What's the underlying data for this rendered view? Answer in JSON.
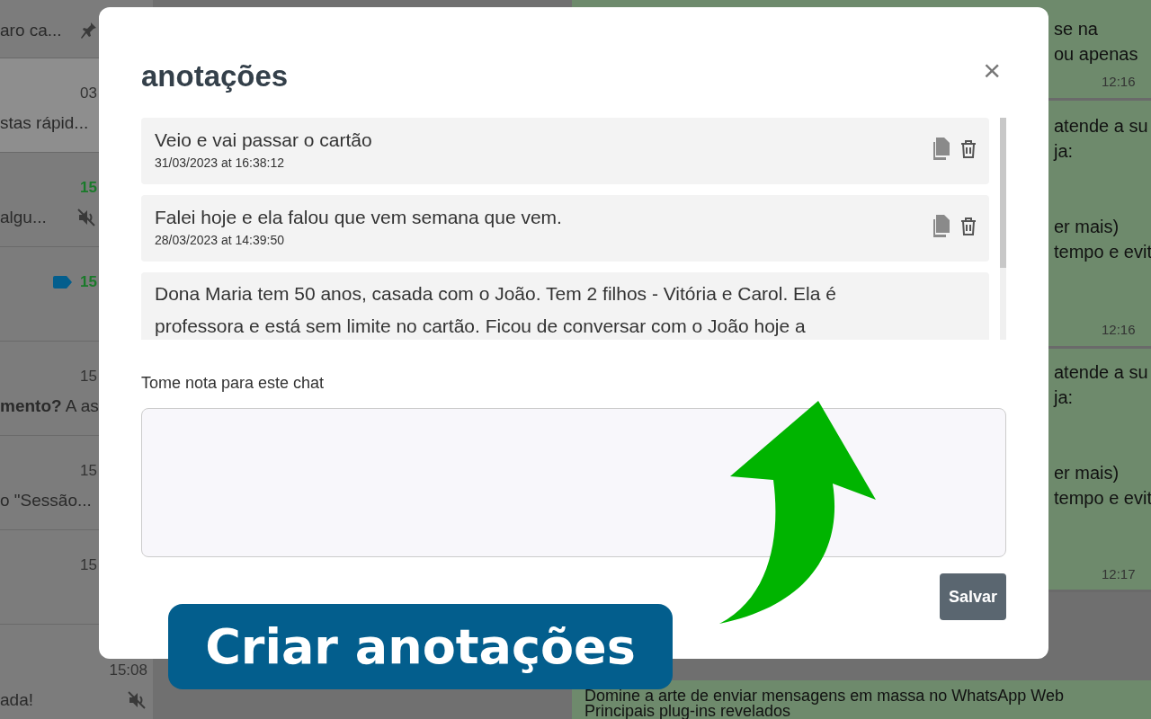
{
  "chat_list": [
    {
      "kind": "pin",
      "preview": "aro ca...",
      "selected": false
    },
    {
      "time": "03",
      "unread": false,
      "preview": "stas rápid...",
      "selected": true
    },
    {
      "time": "15",
      "unread": true,
      "kind": "muted",
      "preview": "algu...",
      "selected": false
    },
    {
      "time": "15",
      "unread": true,
      "kind": "tag",
      "selected": false
    },
    {
      "time": "15",
      "unread": false,
      "preview": "**mento?** A as",
      "selected": false
    },
    {
      "time": "15",
      "unread": false,
      "preview": "o \"Sessão...",
      "selected": false
    },
    {
      "time": "15",
      "unread": false,
      "selected": false
    },
    {
      "time": "15:08",
      "unread": false,
      "kind": "muted",
      "preview": "ada!",
      "selected": false
    }
  ],
  "messages": [
    {
      "paragraphs": [
        [
          "se na",
          "ou apenas"
        ]
      ],
      "time": "12:16"
    },
    {
      "paragraphs": [
        [
          "atende a su",
          "ja:"
        ],
        [
          "er mais)",
          "tempo e evit"
        ]
      ],
      "time": "12:16"
    },
    {
      "paragraphs": [
        [
          "atende a su",
          "ja:"
        ],
        [
          "er mais)",
          "tempo e evit"
        ]
      ],
      "time": "12:17"
    },
    {
      "paragraphs": [
        [
          "Domine a arte de enviar mensagens em massa no WhatsApp Web",
          "Principais plug-ins revelados"
        ]
      ]
    }
  ],
  "dialog": {
    "title": "anotações",
    "close": "×",
    "notes": [
      {
        "text": "Veio e vai passar o cartão",
        "date": "31/03/2023 at 16:38:12"
      },
      {
        "text": "Falei hoje e ela falou que vem semana que vem.",
        "date": "28/03/2023 at 14:39:50"
      },
      {
        "text": "Dona Maria tem 50 anos, casada com o João. Tem 2 filhos - Vitória e Carol. Ela é professora e está sem limite no cartão. Ficou de conversar com o João hoje a"
      }
    ],
    "label": "Tome nota para este chat",
    "save": "Salvar"
  },
  "banner": "Criar anotações"
}
